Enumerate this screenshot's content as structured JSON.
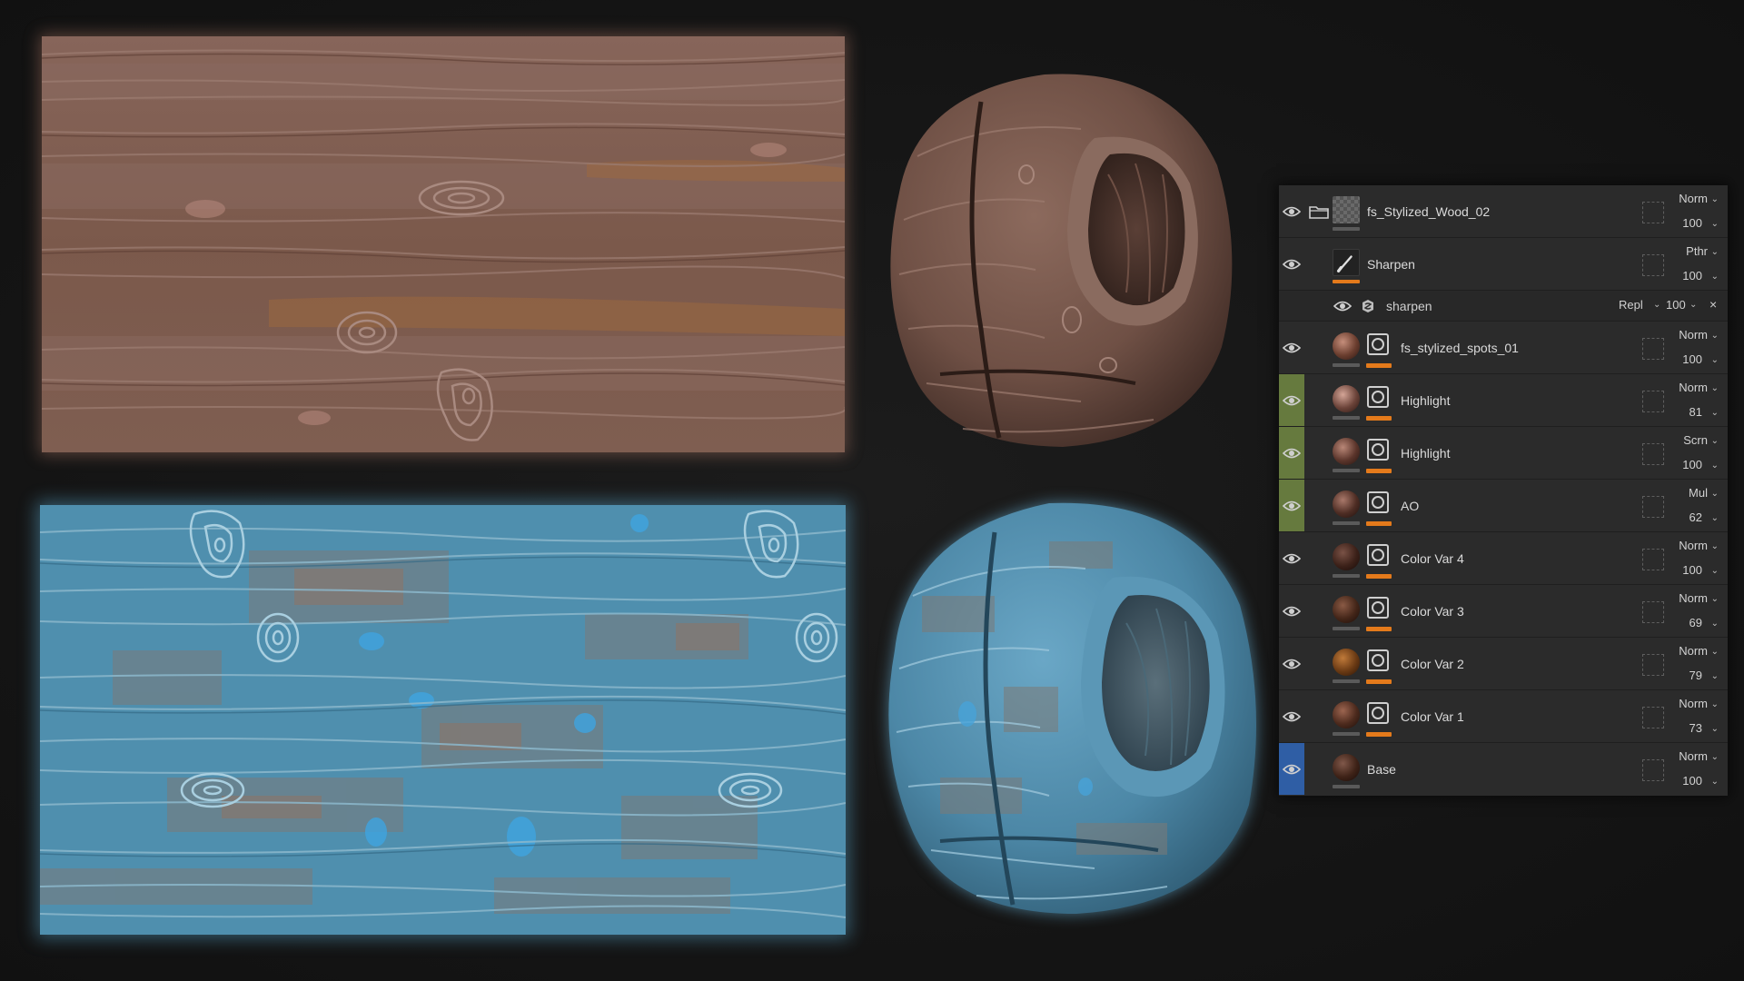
{
  "colors": {
    "panel_bg": "#2b2b2b",
    "accent_orange": "#e47a1b",
    "tag_green": "#667a3e",
    "tag_blue": "#2f5ea5",
    "wood_brown": "#7d5a4c",
    "wood_blue": "#4f8fae"
  },
  "viewport": {
    "swatches": [
      {
        "name": "brown-wood-texture"
      },
      {
        "name": "blue-painted-wood-texture"
      }
    ],
    "spheres": [
      {
        "name": "brown-wood-sphere-preview"
      },
      {
        "name": "blue-painted-wood-sphere-preview"
      }
    ]
  },
  "layers_panel": {
    "layers": [
      {
        "kind": "folder",
        "name": "fs_Stylized_Wood_02",
        "blend": "Norm",
        "opacity": "100",
        "tag": null,
        "thumb": "checker-thumb",
        "mask": false,
        "visible": true
      },
      {
        "kind": "paint",
        "name": "Sharpen",
        "blend": "Pthr",
        "opacity": "100",
        "tag": null,
        "thumb": "brush-thumb",
        "mask": false,
        "visible": true
      },
      {
        "kind": "filter",
        "name": "sharpen",
        "blend": "Repl",
        "opacity": "100",
        "visible": true
      },
      {
        "kind": "fill",
        "name": "fs_stylized_spots_01",
        "blend": "Norm",
        "opacity": "100",
        "tag": null,
        "thumb": "sphere-thumb",
        "mask": true,
        "visible": true
      },
      {
        "kind": "fill",
        "name": "Highlight",
        "blend": "Norm",
        "opacity": "81",
        "tag": "green",
        "thumb": "sphere-thumb",
        "mask": true,
        "visible": true
      },
      {
        "kind": "fill",
        "name": "Highlight",
        "blend": "Scrn",
        "opacity": "100",
        "tag": "green",
        "thumb": "sphere-thumb",
        "mask": true,
        "visible": true
      },
      {
        "kind": "fill",
        "name": "AO",
        "blend": "Mul",
        "opacity": "62",
        "tag": "green",
        "thumb": "sphere-thumb",
        "mask": true,
        "visible": true
      },
      {
        "kind": "fill",
        "name": "Color Var 4",
        "blend": "Norm",
        "opacity": "100",
        "tag": null,
        "thumb": "sphere-thumb",
        "mask": true,
        "visible": true
      },
      {
        "kind": "fill",
        "name": "Color Var 3",
        "blend": "Norm",
        "opacity": "69",
        "tag": null,
        "thumb": "sphere-thumb",
        "mask": true,
        "visible": true
      },
      {
        "kind": "fill",
        "name": "Color Var 2",
        "blend": "Norm",
        "opacity": "79",
        "tag": null,
        "thumb": "sphere-thumb",
        "mask": true,
        "visible": true
      },
      {
        "kind": "fill",
        "name": "Color Var 1",
        "blend": "Norm",
        "opacity": "73",
        "tag": null,
        "thumb": "sphere-thumb",
        "mask": true,
        "visible": true
      },
      {
        "kind": "fill",
        "name": "Base",
        "blend": "Norm",
        "opacity": "100",
        "tag": "blue",
        "thumb": "sphere-thumb",
        "mask": false,
        "visible": true
      }
    ],
    "filter_close_glyph": "×",
    "caret_glyph": "⌄"
  }
}
